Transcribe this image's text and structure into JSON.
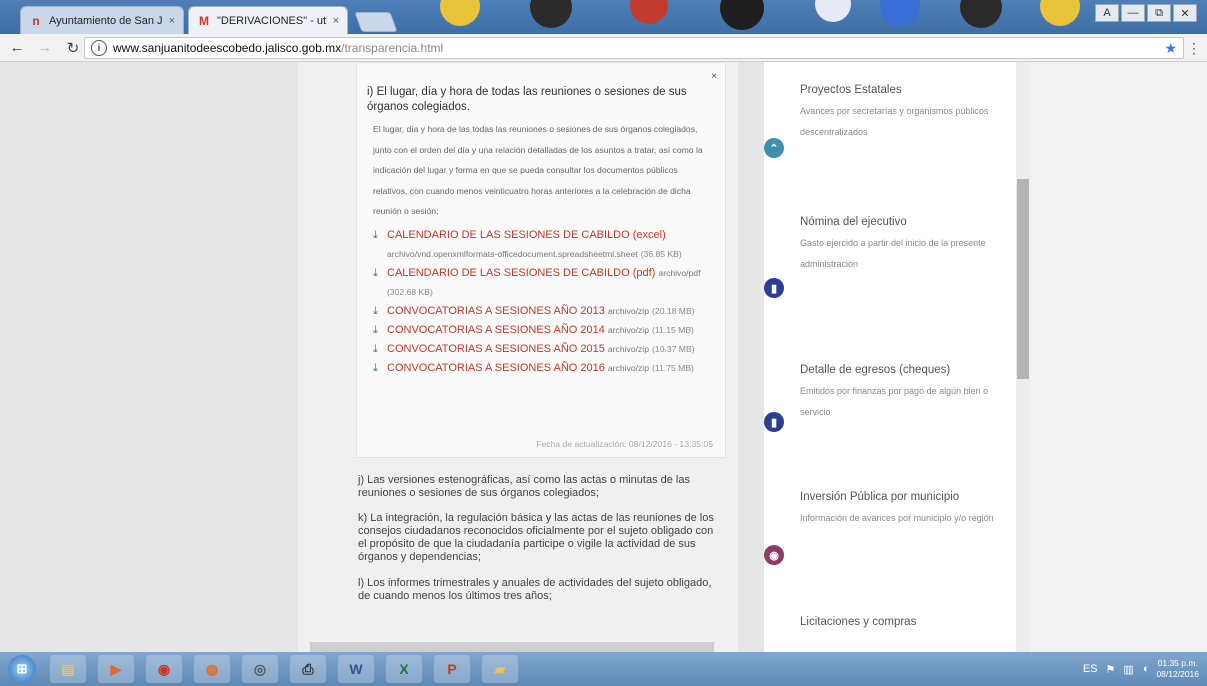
{
  "browser": {
    "tabs": [
      {
        "favicon": "n-favicon-icon",
        "label": "Ayuntamiento de San J",
        "active": false
      },
      {
        "favicon": "gmail-icon",
        "label": "\"DERIVACIONES\" - utm",
        "active": true
      }
    ],
    "close_glyph": "×",
    "window_controls": [
      "A",
      "—",
      "⧉",
      "✕"
    ],
    "address": {
      "host": "www.sanjuanitodeescobedo.jalisco.gob.mx",
      "path": "/transparencia.html"
    }
  },
  "popup": {
    "close": "×",
    "title": "i) El lugar, día y hora de todas las reuniones o sesiones de sus órganos colegiados.",
    "description": "El lugar, día y hora de las todas las reuniones o sesiones de sus órganos colegiados, junto con el orden del día y una relación detalladas de los asuntos a tratar, así como la indicación del lugar y forma en que se pueda consultar los documentos públicos relativos, con cuando menos veinticuatro horas anteriores a la celebración de dicha reunión o sesión;",
    "files": [
      {
        "name": "CALENDARIO DE LAS SESIONES DE CABILDO (excel)",
        "type": "archivo/vnd.openxmlformats-officedocument.spreadsheetml.sheet",
        "size": "(36.85 KB)"
      },
      {
        "name": "CALENDARIO DE LAS SESIONES DE CABILDO (pdf)",
        "type": "archivo/pdf",
        "size": "(302.68 KB)"
      },
      {
        "name": "CONVOCATORIAS A SESIONES AÑO 2013",
        "type": "archivo/zip",
        "size": "(20.18 MB)"
      },
      {
        "name": "CONVOCATORIAS A SESIONES AÑO 2014",
        "type": "archivo/zip",
        "size": "(11.15 MB)"
      },
      {
        "name": "CONVOCATORIAS A SESIONES AÑO 2015",
        "type": "archivo/zip",
        "size": "(10.37 MB)"
      },
      {
        "name": "CONVOCATORIAS A SESIONES AÑO 2016",
        "type": "archivo/zip",
        "size": "(11.75 MB)"
      }
    ],
    "updated": "Fecha de actualización: 08/12/2016 - 13:35:05"
  },
  "items": [
    "j) Las versiones estenográficas, así como las actas o minutas de las reuniones o sesiones de sus órganos colegiados;",
    "k) La integración, la regulación básica y las actas de las reuniones de los consejos ciudadanos reconocidos oficialmente por el sujeto obligado con el propósito de que la ciudadanía participe o vigile la actividad de sus órganos y dependencias;",
    "l) Los informes trimestrales y anuales de actividades del sujeto obligado, de cuando menos los últimos tres años;"
  ],
  "sidebar": [
    {
      "title": "Proyectos Estatales",
      "desc": "Avances por secretarías y organismos públicos descentralizados",
      "icon": "chevrons-up-icon",
      "icon_glyph": "⌃",
      "color": "#3d8fb0"
    },
    {
      "title": "Nómina del ejecutivo",
      "desc": "Gasto ejercido a partir del inicio de la presente administración",
      "icon": "document-icon",
      "icon_glyph": "▮",
      "color": "#2c3e8f"
    },
    {
      "title": "Detalle de egresos (cheques)",
      "desc": "Emitidos por finanzas por pago de algún bien o servicio",
      "icon": "document-icon",
      "icon_glyph": "▮",
      "color": "#2c3e8f"
    },
    {
      "title": "Inversión Pública por municipio",
      "desc": "Información de avances por municipio y/o región",
      "icon": "location-icon",
      "icon_glyph": "◉",
      "color": "#8e3a6b"
    },
    {
      "title": "Licitaciones y compras",
      "desc": "",
      "icon": "",
      "icon_glyph": "",
      "color": ""
    }
  ],
  "taskbar": {
    "start_glyph": "⊞",
    "apps": [
      {
        "name": "explorer-icon",
        "glyph": "▤",
        "color": "#e8c25a"
      },
      {
        "name": "media-player-icon",
        "glyph": "▶",
        "color": "#e06a2a"
      },
      {
        "name": "chrome-icon",
        "glyph": "◉",
        "color": "#d93025"
      },
      {
        "name": "firefox-icon",
        "glyph": "◍",
        "color": "#e66a1f"
      },
      {
        "name": "webcam-icon",
        "glyph": "◎",
        "color": "#555555"
      },
      {
        "name": "printer-icon",
        "glyph": "⎙",
        "color": "#333333"
      },
      {
        "name": "word-icon",
        "glyph": "W",
        "color": "#2b5797"
      },
      {
        "name": "excel-icon",
        "glyph": "X",
        "color": "#1e7145"
      },
      {
        "name": "powerpoint-icon",
        "glyph": "P",
        "color": "#c43e1c"
      },
      {
        "name": "folder-icon",
        "glyph": "▰",
        "color": "#e8c25a"
      }
    ],
    "lang": "ES",
    "time": "01:35 p.m.",
    "date": "08/12/2016"
  }
}
